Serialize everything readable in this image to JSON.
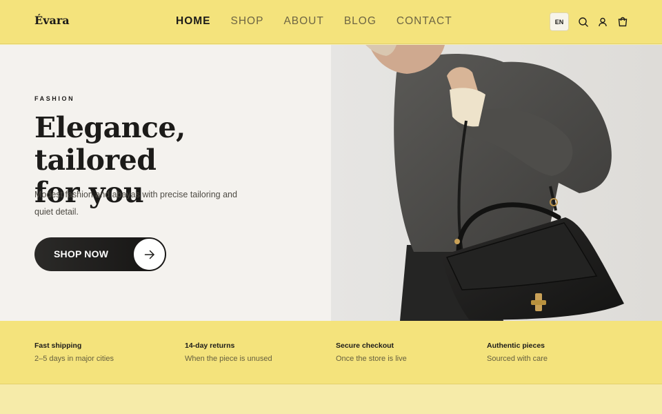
{
  "header": {
    "logo": "Évara",
    "nav": [
      "HOME",
      "SHOP",
      "ABOUT",
      "BLOG",
      "CONTACT"
    ],
    "active_nav": "HOME",
    "language": "EN",
    "icons": [
      "search-icon",
      "user-icon",
      "cart-icon"
    ]
  },
  "hero": {
    "eyebrow": "FASHION",
    "headline_line1": "Elegance, tailored",
    "headline_line2": "for you",
    "subtext": "Modest fashion and abayas with precise tailoring and quiet detail.",
    "cta_label": "SHOP NOW",
    "cta_icon": "arrow-right-icon"
  },
  "features": [
    {
      "title": "Fast shipping",
      "desc": "2–5 days in major cities"
    },
    {
      "title": "14-day returns",
      "desc": "When the piece is unused"
    },
    {
      "title": "Secure checkout",
      "desc": "Once the store is live"
    },
    {
      "title": "Authentic pieces",
      "desc": "Sourced with care"
    }
  ],
  "colors": {
    "header_bg": "#f4e37c",
    "hero_left_bg": "#f4f2ee",
    "text_dark": "#1c1b19",
    "cta_bg": "#1c1b19"
  }
}
